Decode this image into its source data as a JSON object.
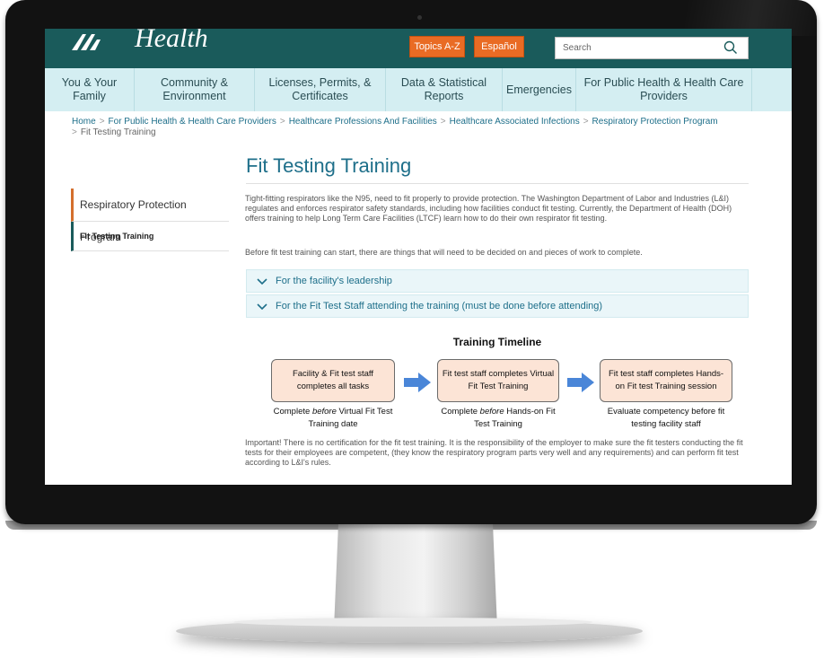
{
  "header": {
    "logo_text": "Health",
    "topics_button": "Topics A-Z",
    "espanol_button": "Español",
    "search_placeholder": "Search"
  },
  "nav": {
    "items": [
      {
        "label": "You & Your Family"
      },
      {
        "label": "Community & Environment"
      },
      {
        "label": "Licenses, Permits, & Certificates"
      },
      {
        "label": "Data & Statistical Reports"
      },
      {
        "label": "Emergencies"
      },
      {
        "label": "For Public Health & Health Care Providers"
      }
    ]
  },
  "breadcrumb": {
    "items": [
      "Home",
      "For Public Health & Health Care Providers",
      "Healthcare Professions And Facilities",
      "Healthcare Associated Infections",
      "Respiratory Protection Program"
    ],
    "current": "Fit Testing Training"
  },
  "page": {
    "title": "Fit Testing Training",
    "intro": "Tight-fitting respirators like the N95, need to fit properly to provide protection. The Washington Department of Labor and Industries (L&I) regulates and enforces respirator safety standards, including how facilities conduct fit testing. Currently, the Department of Health (DOH) offers training to help Long Term Care Facilities (LTCF) learn how to do their own respirator fit testing.",
    "before_text": "Before fit test training can start, there are things that will need to be decided on and pieces of work to complete.",
    "important": "Important! There is no certification for the fit test training. It is the responsibility of the employer to make sure the fit testers conducting the fit tests for their employees are competent, (they know the respiratory program parts very well and any requirements) and can perform fit test according to L&I's rules."
  },
  "sidebar": {
    "parent": "Respiratory Protection Program",
    "current": "Fit Testing Training"
  },
  "accordion": [
    {
      "label": "For the facility's leadership"
    },
    {
      "label": "For the Fit Test Staff attending the training (must be done before attending)"
    }
  ],
  "timeline": {
    "title": "Training Timeline",
    "steps": [
      {
        "box": "Facility & Fit test staff completes all tasks",
        "caption_pre": "Complete ",
        "caption_em": "before",
        "caption_post": " Virtual Fit Test Training date"
      },
      {
        "box": "Fit test staff completes Virtual Fit Test Training",
        "caption_pre": "Complete ",
        "caption_em": "before",
        "caption_post": " Hands-on Fit Test Training"
      },
      {
        "box": "Fit test staff completes Hands-on Fit test Training session",
        "caption_pre": "Evaluate competency before fit testing facility staff",
        "caption_em": "",
        "caption_post": ""
      }
    ]
  },
  "colors": {
    "header_teal": "#1a5b5b",
    "nav_bg": "#d4eef2",
    "accent_orange": "#e96b24",
    "link_blue": "#1e6f8a",
    "box_fill": "#fce4d6",
    "arrow_blue": "#4a86d8"
  }
}
